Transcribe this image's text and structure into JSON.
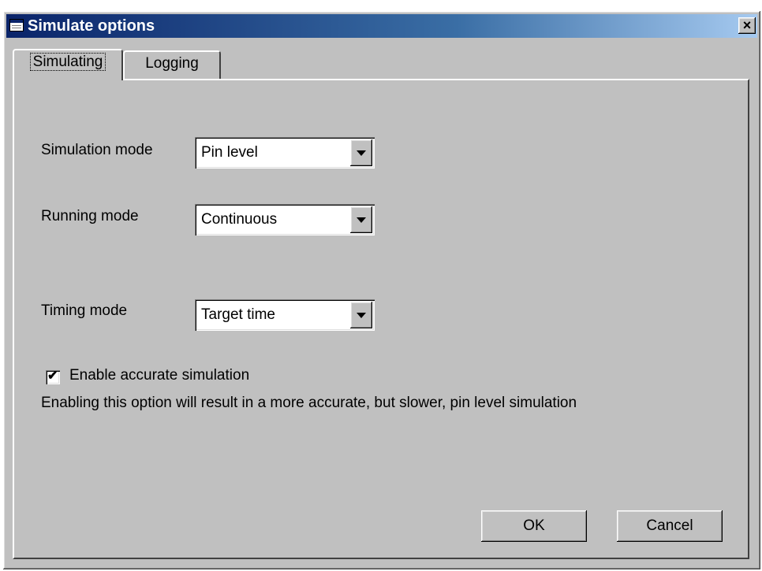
{
  "window": {
    "title": "Simulate options",
    "close_glyph": "×"
  },
  "tabs": [
    {
      "label": "Simulating",
      "selected": true
    },
    {
      "label": "Logging",
      "selected": false
    }
  ],
  "fields": {
    "simulation_mode": {
      "label": "Simulation mode",
      "value": "Pin level"
    },
    "running_mode": {
      "label": "Running mode",
      "value": "Continuous"
    },
    "timing_mode": {
      "label": "Timing mode",
      "value": "Target time"
    }
  },
  "accurate_simulation": {
    "label": "Enable accurate simulation",
    "checked": true,
    "check_glyph": "✔",
    "description": "Enabling this option will result in a more accurate, but slower, pin level simulation"
  },
  "buttons": {
    "ok": "OK",
    "cancel": "Cancel"
  },
  "icons": {
    "title": "window-app-icon",
    "close": "close-icon",
    "dropdown": "chevron-down-icon"
  },
  "colors": {
    "dialog_face": "#c0c0c0",
    "titlebar_start": "#0a246a",
    "titlebar_end": "#a6caf0"
  }
}
